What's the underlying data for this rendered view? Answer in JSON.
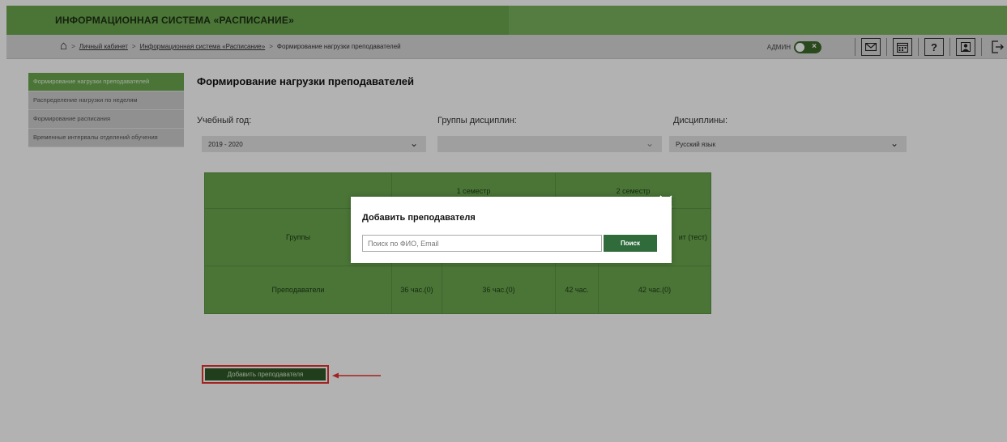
{
  "header": {
    "brand": "ИНФОРМАЦИОННАЯ СИСТЕМА «РАСПИСАНИЕ»"
  },
  "breadcrumb": {
    "items": [
      "Личный кабинет",
      "Информационная система «Расписание»",
      "Формирование нагрузки преподавателей"
    ],
    "separator": ">"
  },
  "user": {
    "role": "АДМИН",
    "toggle_mark": "×"
  },
  "nav_icons": [
    "mail-icon",
    "calendar-icon",
    "help-icon",
    "profile-icon",
    "logout-icon"
  ],
  "nav_icon_glyphs": {
    "help": "?"
  },
  "sidebar": {
    "items": [
      {
        "label": "Формирование нагрузки преподавателей",
        "active": true
      },
      {
        "label": "Распределение нагрузки по неделям",
        "active": false
      },
      {
        "label": "Формирование расписания",
        "active": false
      },
      {
        "label": "Временные интервалы отделений обучения",
        "active": false
      }
    ]
  },
  "main": {
    "title": "Формирование нагрузки преподавателей",
    "filters": {
      "year": {
        "label": "Учебный год:",
        "value": "2019 - 2020"
      },
      "groups": {
        "label": "Группы дисциплин:",
        "value": ""
      },
      "discipline": {
        "label": "Дисциплины:",
        "value": "Русский язык"
      }
    },
    "table": {
      "semester1": "1 семестр",
      "semester2": "2 семестр",
      "groups_label": "Группы",
      "partial_header": "ит (тест)",
      "teachers_label": "Преподаватели",
      "cells": [
        "36 час.(0)",
        "36 час.(0)",
        "42 час.",
        "42 час.(0)"
      ]
    },
    "add_button": "Добавить преподавателя"
  },
  "modal": {
    "title": "Добавить преподавателя",
    "search_placeholder": "Поиск по ФИО, Email",
    "search_button": "Поиск"
  },
  "colors": {
    "green": "#6aa84f",
    "dark_green": "#2f5a27",
    "highlight": "#e8332f"
  }
}
